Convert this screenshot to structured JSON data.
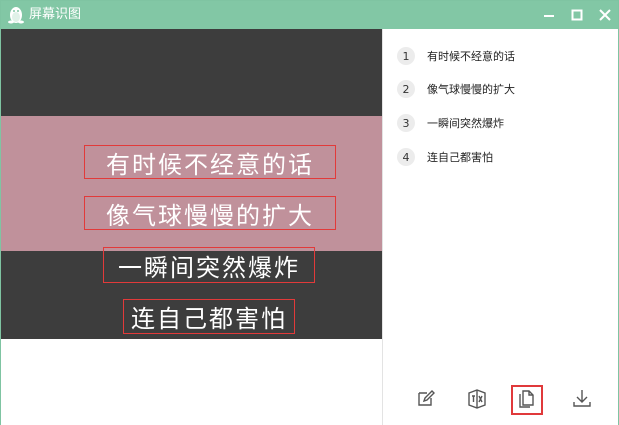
{
  "window": {
    "title": "屏幕识图"
  },
  "ocr_lines": [
    "有时候不经意的话",
    "像气球慢慢的扩大",
    "一瞬间突然爆炸",
    "连自己都害怕"
  ],
  "results": [
    {
      "num": "1",
      "text": "有时候不经意的话"
    },
    {
      "num": "2",
      "text": "像气球慢慢的扩大"
    },
    {
      "num": "3",
      "text": "一瞬间突然爆炸"
    },
    {
      "num": "4",
      "text": "连自己都害怕"
    }
  ],
  "toolbar": {
    "icons": [
      "edit-icon",
      "translate-icon",
      "copy-icon",
      "download-icon"
    ],
    "selected": "copy-icon"
  },
  "colors": {
    "titlebar": "#82c7a5",
    "highlight": "#e23a3a",
    "band": "#c0919b"
  }
}
